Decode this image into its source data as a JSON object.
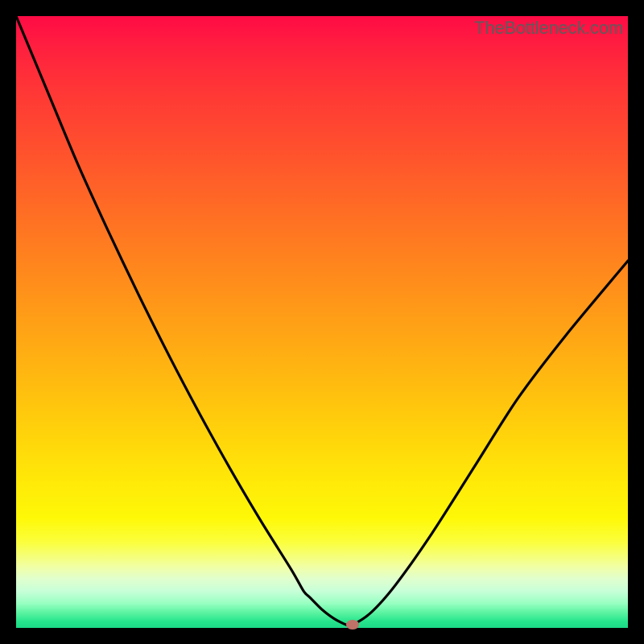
{
  "watermark": "TheBottleneck.com",
  "colors": {
    "frame": "#000000",
    "curve": "#000000",
    "marker": "#bf7268"
  },
  "chart_data": {
    "type": "line",
    "title": "",
    "xlabel": "",
    "ylabel": "",
    "xlim": [
      0,
      100
    ],
    "ylim": [
      0,
      100
    ],
    "grid": false,
    "legend": false,
    "series": [
      {
        "name": "bottleneck-curve",
        "x": [
          0,
          5,
          10,
          15,
          20,
          25,
          30,
          35,
          40,
          45,
          47,
          48,
          50,
          52,
          54,
          55,
          58,
          62,
          68,
          75,
          82,
          90,
          100
        ],
        "values": [
          100,
          88,
          76,
          65,
          54.5,
          44.5,
          35,
          26,
          17.5,
          9.5,
          6,
          5,
          3,
          1.5,
          0.5,
          0.5,
          2.5,
          7,
          15.5,
          26.5,
          37.5,
          48,
          60
        ]
      }
    ],
    "marker": {
      "x": 55,
      "y": 0.5
    }
  }
}
